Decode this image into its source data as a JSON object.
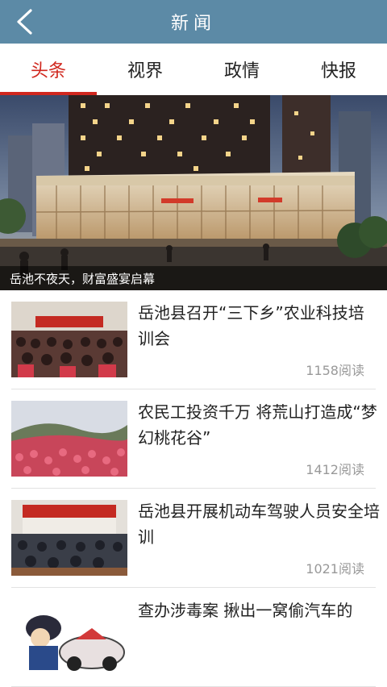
{
  "header": {
    "title": "新闻",
    "back_icon": "chevron-left-icon"
  },
  "tabs": [
    {
      "label": "头条",
      "active": true
    },
    {
      "label": "视界",
      "active": false
    },
    {
      "label": "政情",
      "active": false
    },
    {
      "label": "快报",
      "active": false
    }
  ],
  "banner": {
    "caption": "岳池不夜天，财富盛宴启幕"
  },
  "news": [
    {
      "title": "岳池县召开“三下乡”农业科技培训会",
      "reads": "1158阅读"
    },
    {
      "title": "农民工投资千万 将荒山打造成“梦幻桃花谷”",
      "reads": "1412阅读"
    },
    {
      "title": "岳池县开展机动车驾驶人员安全培训",
      "reads": "1021阅读"
    },
    {
      "title": "查办涉毒案 揪出一窝偷汽车的",
      "reads": ""
    }
  ],
  "colors": {
    "header_bg": "#5c8aa6",
    "accent": "#d0271e"
  }
}
